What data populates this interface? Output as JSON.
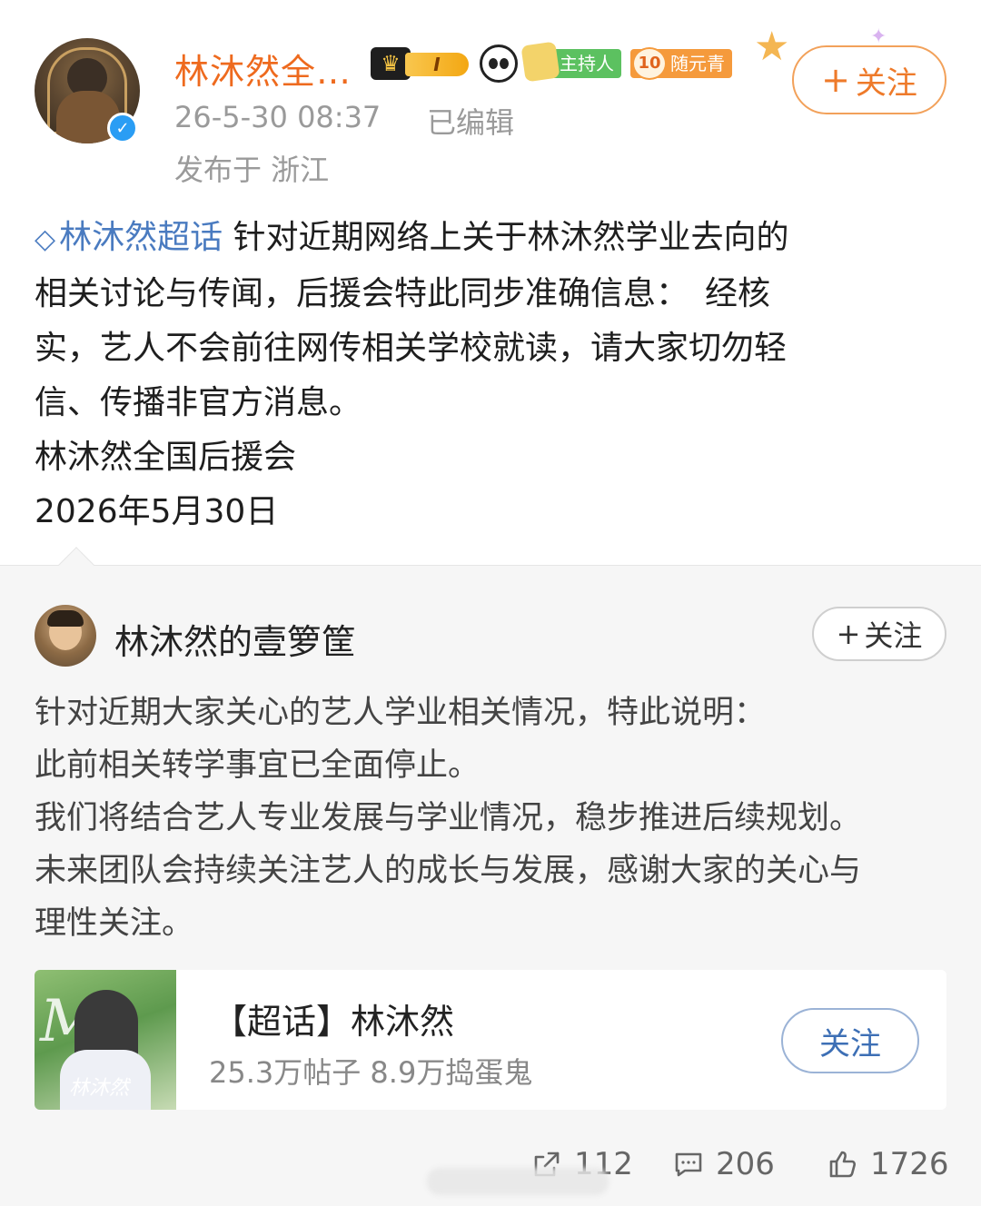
{
  "post": {
    "username": "林沐然全…",
    "badges": {
      "crown_tag": "I",
      "host_label": "主持人",
      "level_num": "10",
      "level_label": "随元青"
    },
    "follow_label": "关注",
    "follow_plus": "+",
    "time": "26-5-30 08:37",
    "edited": "已编辑",
    "location": "发布于 浙江",
    "topic_link": "林沐然超话",
    "body_lines": [
      "针对近期网络上关于林沐然学业去向的",
      "相关讨论与传闻，后援会特此同步准确信息：　经核",
      "实，艺人不会前往网传相关学校就读，请大家切勿轻",
      "信、传播非官方消息。",
      "林沐然全国后援会",
      "2026年5月30日"
    ]
  },
  "repost": {
    "username": "林沐然的壹箩筐",
    "follow_label": "关注",
    "follow_plus": "+",
    "body_lines": [
      "针对近期大家关心的艺人学业相关情况，特此说明：",
      "此前相关转学事宜已全面停止。",
      "我们将结合艺人专业发展与学业情况，稳步推进后续规划。",
      "未来团队会持续关注艺人的成长与发展，感谢大家的关心与",
      "理性关注。"
    ],
    "topic_card": {
      "title": "【超话】林沐然",
      "stats": "25.3万帖子 8.9万捣蛋鬼",
      "follow_label": "关注",
      "thumb_text": "林沐然"
    }
  },
  "actions": {
    "repost_count": "112",
    "comment_count": "206",
    "like_count": "1726"
  },
  "colors": {
    "accent_orange": "#ee6a1e",
    "topic_blue": "#4a7bc0",
    "verified_blue": "#2a9df4"
  }
}
